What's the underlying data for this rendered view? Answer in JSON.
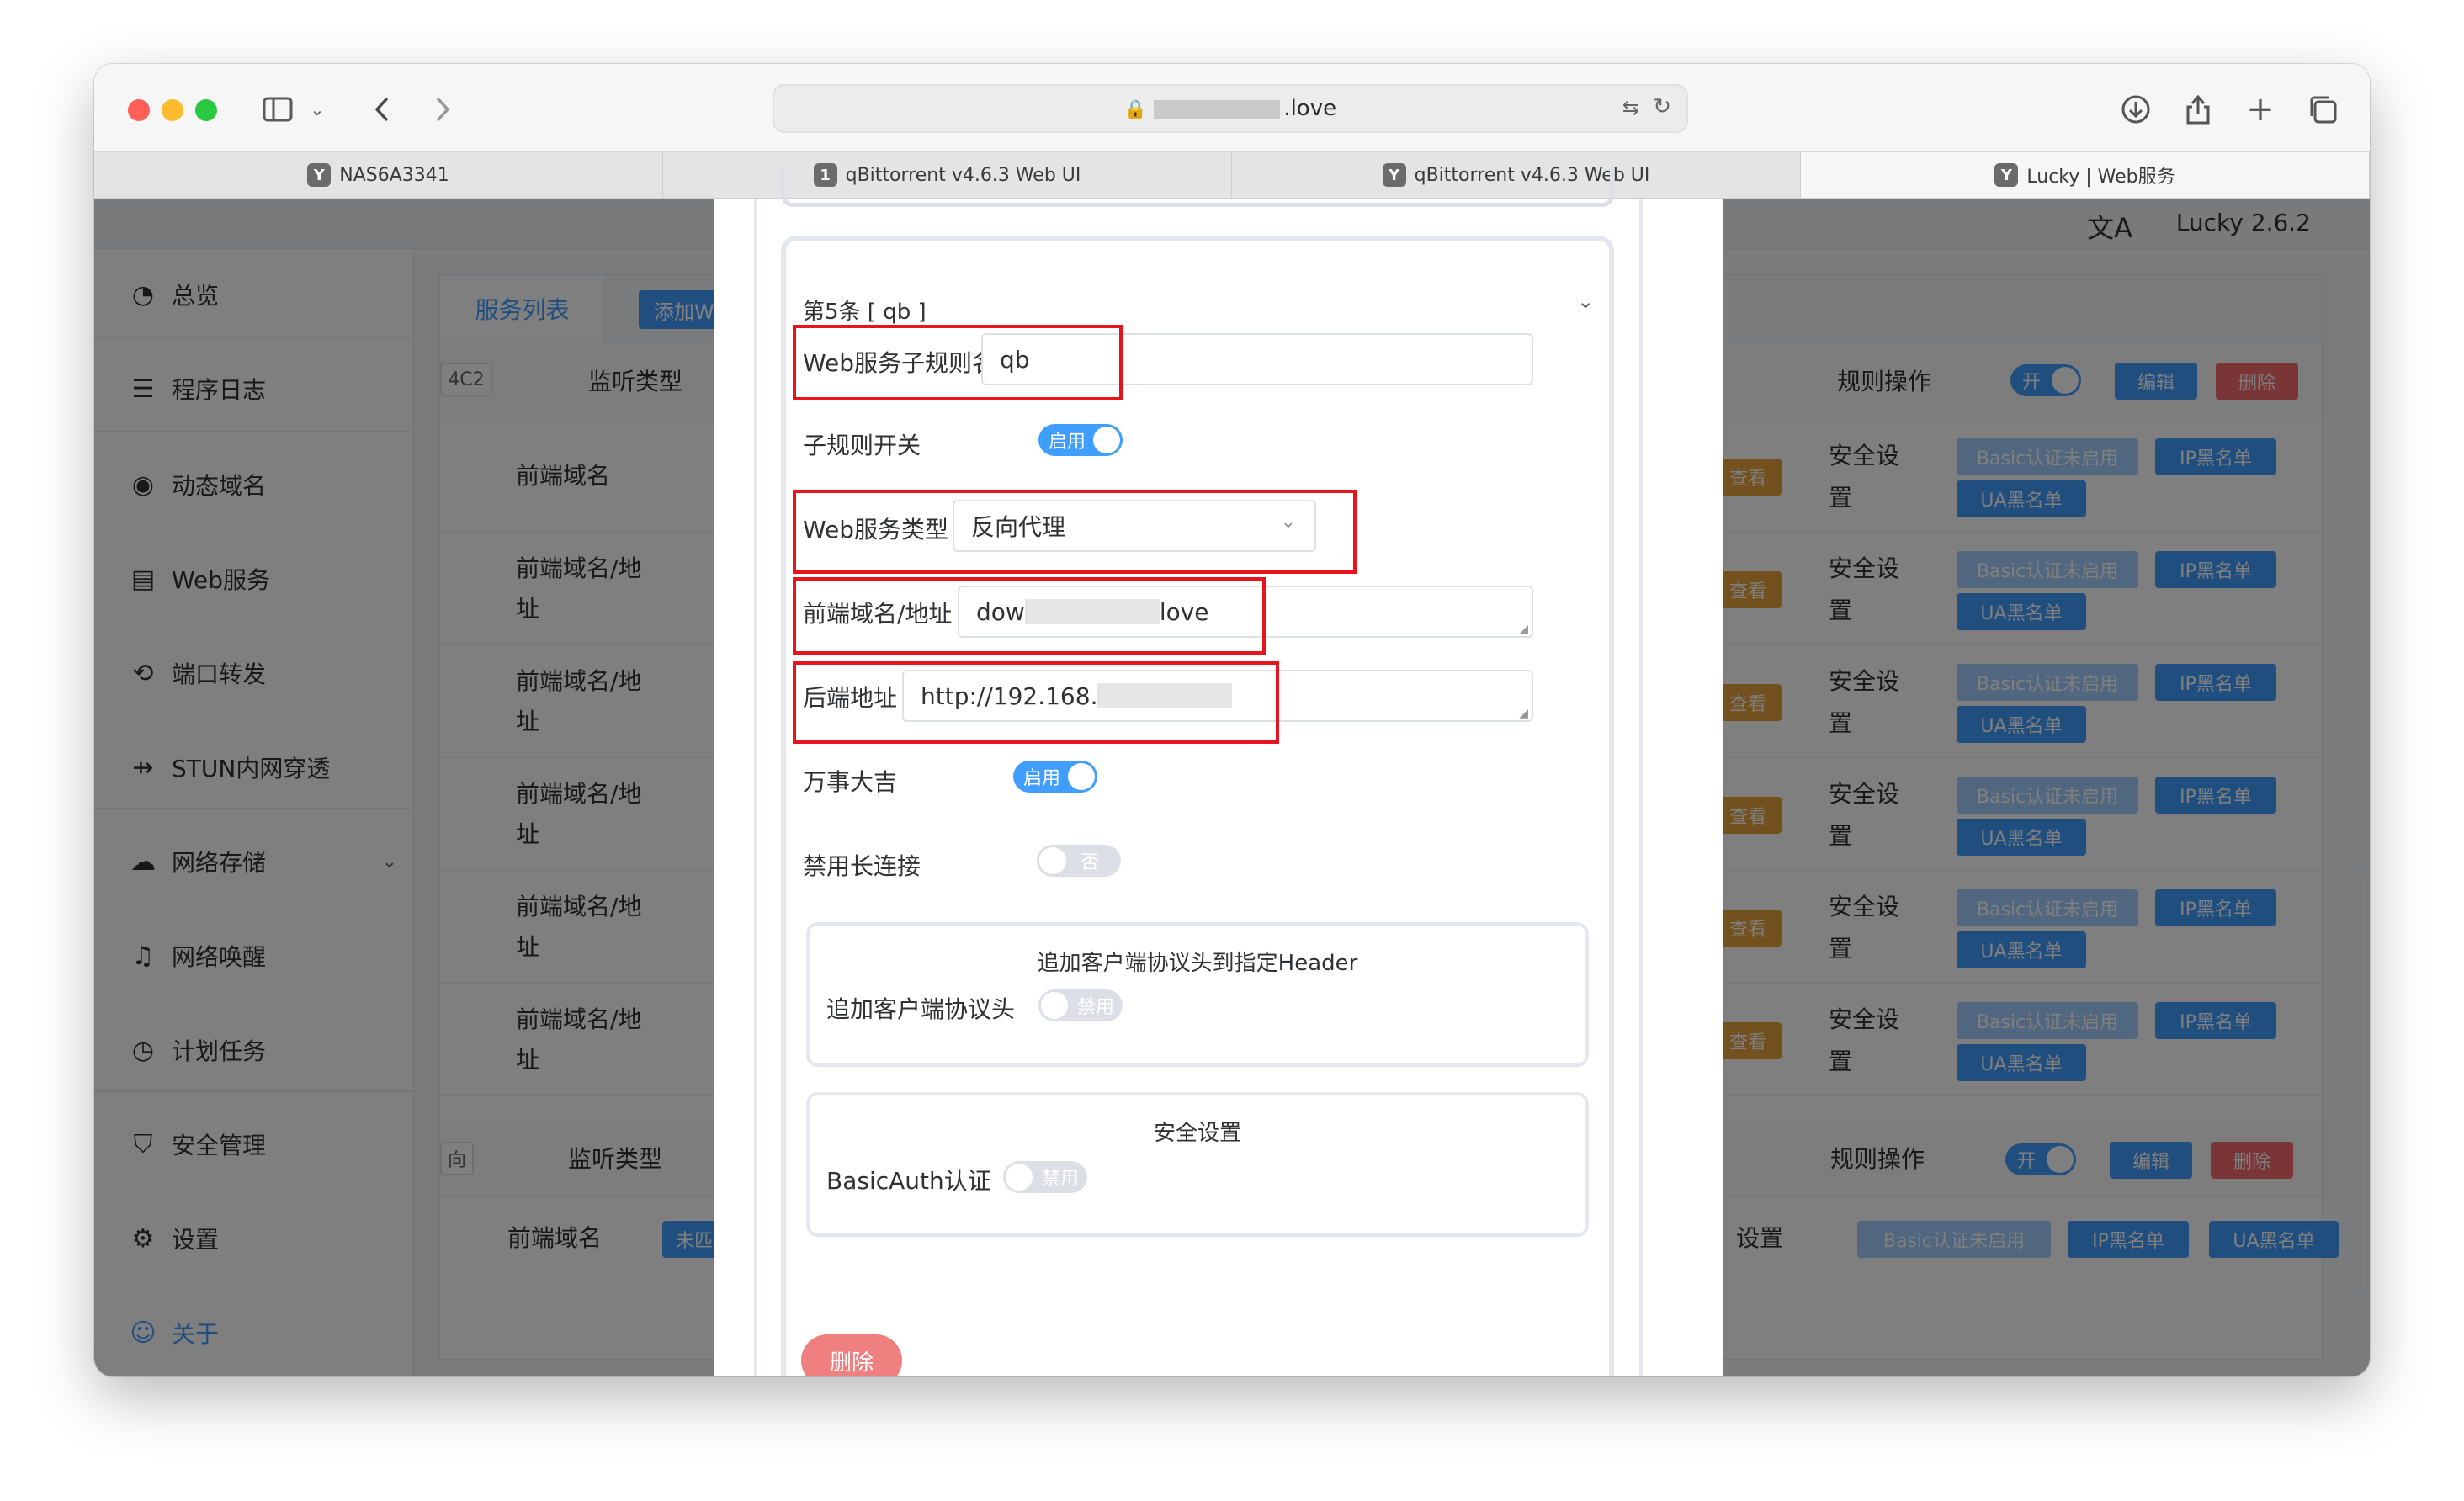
{
  "browser": {
    "url": ".love",
    "tabs": [
      {
        "label": "NAS6A3341",
        "favicon": "Y"
      },
      {
        "label": "qBittorrent v4.6.3 Web UI",
        "favicon": "1"
      },
      {
        "label": "qBittorrent v4.6.3 Web UI",
        "favicon": "Y"
      },
      {
        "label": "Lucky | Web服务",
        "favicon": "Y"
      }
    ]
  },
  "app": {
    "version": "Lucky 2.6.2",
    "sidebar": [
      "总览",
      "程序日志",
      "动态域名",
      "Web服务",
      "端口转发",
      "STUN内网穿透",
      "网络存储",
      "网络唤醒",
      "计划任务",
      "安全管理",
      "设置",
      "关于"
    ],
    "panel_tabs": {
      "active": "服务列表",
      "add": "添加W"
    },
    "bg": {
      "listen_type": "监听类型",
      "rule_ops": "规则操作",
      "on": "开",
      "edit": "编辑",
      "delete": "删除",
      "tag_4c2": "4C2",
      "tag_dir": "向",
      "front_domain": "前端域名",
      "front_domain_addr": "前端域名/地",
      "addr_suffix": "址",
      "view": "查看",
      "security": "安全设",
      "security_suffix": "置",
      "basic_off": "Basic认证未启用",
      "ip_black": "IP黑名单",
      "ua_black": "UA黑名单",
      "unmatched": "未匹",
      "security_settings_tail": "设置"
    }
  },
  "dialog": {
    "rule_title": "第5条 [ qb ]",
    "subrule_name_label": "Web服务子规则名称",
    "subrule_name_value": "qb",
    "subrule_switch_label": "子规则开关",
    "enabled": "启用",
    "service_type_label": "Web服务类型",
    "service_type_value": "反向代理",
    "frontend_label": "前端域名/地址",
    "frontend_prefix": "dow",
    "frontend_suffix": "love",
    "backend_label": "后端地址",
    "backend_prefix": "http://192.168.",
    "lucky_label": "万事大吉",
    "keepalive_label": "禁用长连接",
    "no": "否",
    "header_card_title": "追加客户端协议头到指定Header",
    "header_label": "追加客户端协议头",
    "disabled": "禁用",
    "security_card_title": "安全设置",
    "basic_auth_label": "BasicAuth认证",
    "delete_button": "删除"
  },
  "colors": {
    "primary": "#409eff",
    "danger": "#f56c6c",
    "warning": "#e6a23c",
    "highlight_box": "#e8131d",
    "overlay": "rgba(0,0,0,0.5)"
  }
}
